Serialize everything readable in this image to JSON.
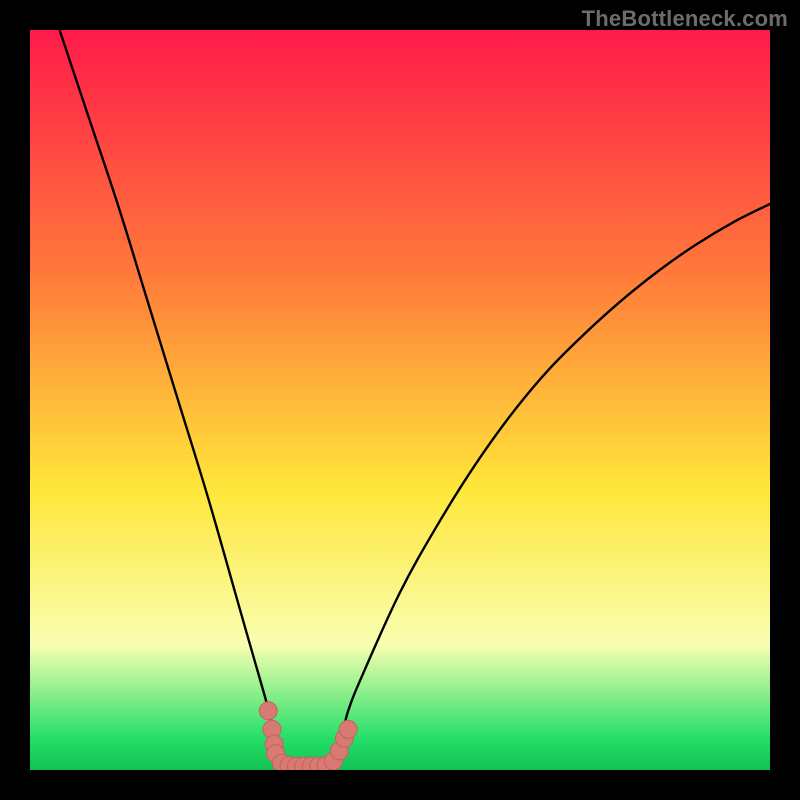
{
  "watermark": "TheBottleneck.com",
  "colors": {
    "black": "#000000",
    "curve": "#000000",
    "marker_fill": "#d87a74",
    "marker_stroke": "#c9605a",
    "grad_top": "#ff1a4a",
    "grad_mid1": "#ff7a3a",
    "grad_mid2": "#ffe63a",
    "grad_band": "#f9ffb0",
    "grad_green": "#27e06a",
    "grad_green_deep": "#11c252"
  },
  "chart_data": {
    "type": "line",
    "title": "",
    "xlabel": "",
    "ylabel": "",
    "xlim": [
      0,
      100
    ],
    "ylim": [
      0,
      100
    ],
    "curve": {
      "name": "bottleneck",
      "comment": "Approximate V-shaped bottleneck curve; y≈100 far from the minimum and ≈0 near x≈34–42.",
      "x": [
        4,
        8,
        12,
        16,
        20,
        24,
        28,
        30,
        32,
        33,
        34,
        36,
        38,
        40,
        41,
        42,
        43,
        45,
        50,
        55,
        60,
        65,
        70,
        75,
        80,
        85,
        90,
        95,
        100
      ],
      "y": [
        100,
        88,
        76,
        63,
        50,
        37,
        23,
        16,
        9,
        5,
        1.5,
        0.5,
        0.5,
        0.5,
        1.5,
        4,
        8,
        13,
        24,
        33,
        41,
        48,
        54,
        59,
        63.5,
        67.5,
        71,
        74,
        76.5
      ]
    },
    "markers": {
      "comment": "Salmon-colored data points along the valley of the curve.",
      "points": [
        {
          "x": 32.2,
          "y": 8.0
        },
        {
          "x": 32.7,
          "y": 5.5
        },
        {
          "x": 33.0,
          "y": 3.5
        },
        {
          "x": 33.2,
          "y": 2.2
        },
        {
          "x": 34.0,
          "y": 0.9
        },
        {
          "x": 35.0,
          "y": 0.6
        },
        {
          "x": 36.0,
          "y": 0.5
        },
        {
          "x": 37.0,
          "y": 0.5
        },
        {
          "x": 38.0,
          "y": 0.5
        },
        {
          "x": 39.0,
          "y": 0.5
        },
        {
          "x": 40.0,
          "y": 0.6
        },
        {
          "x": 41.0,
          "y": 1.2
        },
        {
          "x": 41.8,
          "y": 2.6
        },
        {
          "x": 42.5,
          "y": 4.3
        },
        {
          "x": 43.0,
          "y": 5.5
        }
      ]
    }
  }
}
